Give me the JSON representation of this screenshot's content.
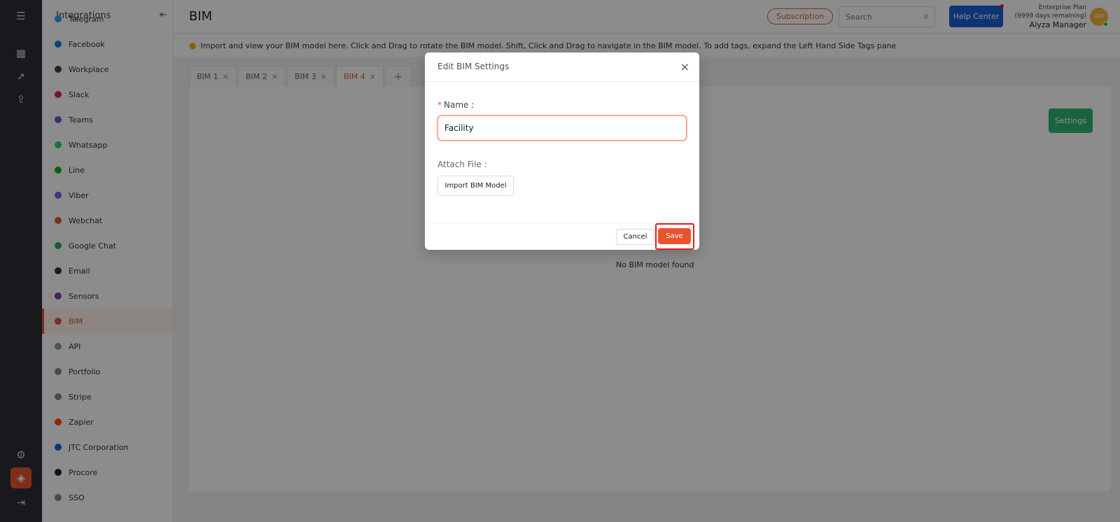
{
  "colors": {
    "accent": "#e8542f",
    "primary": "#1a5fd8",
    "success": "#2eb673",
    "rail": "#2b2f36"
  },
  "rail": {
    "icons": [
      "menu-icon",
      "dashboard-icon",
      "rocket-icon",
      "upload-icon",
      "gear-icon",
      "cube-icon",
      "logout-icon"
    ]
  },
  "sidenav": {
    "title": "Integrations",
    "items": [
      {
        "label": "Telegram",
        "color": "#2aa3e0"
      },
      {
        "label": "Facebook",
        "color": "#1877f2"
      },
      {
        "label": "Workplace",
        "color": "#444444"
      },
      {
        "label": "Slack",
        "color": "#e01e5a"
      },
      {
        "label": "Teams",
        "color": "#5b5fc7"
      },
      {
        "label": "Whatsapp",
        "color": "#25d366"
      },
      {
        "label": "Line",
        "color": "#00b900"
      },
      {
        "label": "Viber",
        "color": "#7360f2"
      },
      {
        "label": "Webchat",
        "color": "#e8542f"
      },
      {
        "label": "Google Chat",
        "color": "#34a853"
      },
      {
        "label": "Email",
        "color": "#333333"
      },
      {
        "label": "Sensors",
        "color": "#7a3ea0"
      },
      {
        "label": "BIM",
        "color": "#e8542f"
      },
      {
        "label": "API",
        "color": "#999999"
      },
      {
        "label": "Portfolio",
        "color": "#888888"
      },
      {
        "label": "Stripe",
        "color": "#888888"
      },
      {
        "label": "Zapier",
        "color": "#ff4a00"
      },
      {
        "label": "JTC Corporation",
        "color": "#1a5fd8"
      },
      {
        "label": "Procore",
        "color": "#222222"
      },
      {
        "label": "SSO",
        "color": "#888888"
      }
    ]
  },
  "header": {
    "title": "BIM",
    "subscription_label": "Subscription",
    "search_placeholder": "Search",
    "help_label": "Help Center",
    "plan_name": "Enterprise Plan",
    "plan_remaining": "(9999 days remaining)",
    "user_name": "Alyza Manager",
    "avatar_initials": "AM"
  },
  "info": "Import and view your BIM model here. Click and Drag to rotate the BIM model. Shift, Click and Drag to navigate in the BIM model. To add tags, expand the Left Hand Side Tags pane",
  "tabs": [
    "BIM 1",
    "BIM 2",
    "BIM 3",
    "BIM 4"
  ],
  "tabs_add": "+",
  "tab_close": "×",
  "content": {
    "settings_label": "Settings",
    "empty_text": "No BIM model found"
  },
  "modal": {
    "title": "Edit BIM Settings",
    "close": "×",
    "name_required": "*",
    "name_label": "Name :",
    "name_value": "Facility",
    "attach_label": "Attach File :",
    "import_label": "Import BIM Model",
    "cancel_label": "Cancel",
    "save_label": "Save"
  }
}
